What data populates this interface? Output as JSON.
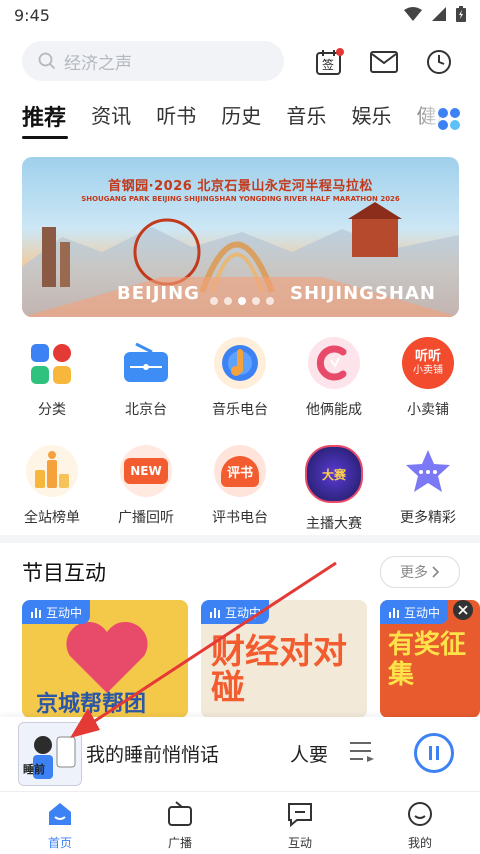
{
  "status": {
    "time": "9:45"
  },
  "search": {
    "placeholder": "经济之声"
  },
  "header_icons": {
    "sign_label": "签"
  },
  "tabs": [
    "推荐",
    "资讯",
    "听书",
    "历史",
    "音乐",
    "娱乐",
    "健康"
  ],
  "banner": {
    "title": "首钢园·2026 北京石景山永定河半程马拉松",
    "subtitle": "SHOUGANG PARK BEIJING SHIJINGSHAN YONGDING RIVER HALF MARATHON 2026",
    "word_left": "BEIJING",
    "word_right": "SHIJINGSHAN",
    "slide_count": 5,
    "active_slide": 2
  },
  "grid_row1": [
    {
      "label": "分类",
      "icon": "category-icon"
    },
    {
      "label": "北京台",
      "icon": "radio-icon"
    },
    {
      "label": "音乐电台",
      "icon": "music-icon"
    },
    {
      "label": "他俩能成",
      "icon": "couple-icon"
    },
    {
      "label": "小卖铺",
      "icon": "shop-icon",
      "icon_text_1": "听听",
      "icon_text_2": "小卖铺"
    }
  ],
  "grid_row2": [
    {
      "label": "全站榜单",
      "icon": "ranking-icon"
    },
    {
      "label": "广播回听",
      "icon": "replay-icon",
      "icon_text": "NEW"
    },
    {
      "label": "评书电台",
      "icon": "storytelling-icon",
      "icon_text": "评书"
    },
    {
      "label": "主播大赛",
      "icon": "contest-icon",
      "icon_text": "大赛"
    },
    {
      "label": "更多精彩",
      "icon": "more-star-icon"
    }
  ],
  "section": {
    "title": "节目互动",
    "more": "更多"
  },
  "cards": [
    {
      "badge": "互动中",
      "caption": "京城帮帮团",
      "bg": "#f4c94a"
    },
    {
      "badge": "互动中",
      "caption": "财经对对碰",
      "bg": "#f3e9d8"
    },
    {
      "badge": "互动中",
      "caption": "有奖征集",
      "bg": "#e85b2e"
    }
  ],
  "player": {
    "title": "我的睡前悄悄话",
    "subtitle": "人要",
    "cover_text": "睡前"
  },
  "bottom_nav": [
    {
      "label": "首页",
      "active": true
    },
    {
      "label": "广播",
      "active": false
    },
    {
      "label": "互动",
      "active": false
    },
    {
      "label": "我的",
      "active": false
    }
  ],
  "colors": {
    "accent": "#3d82f4",
    "arrow": "#e53935"
  }
}
